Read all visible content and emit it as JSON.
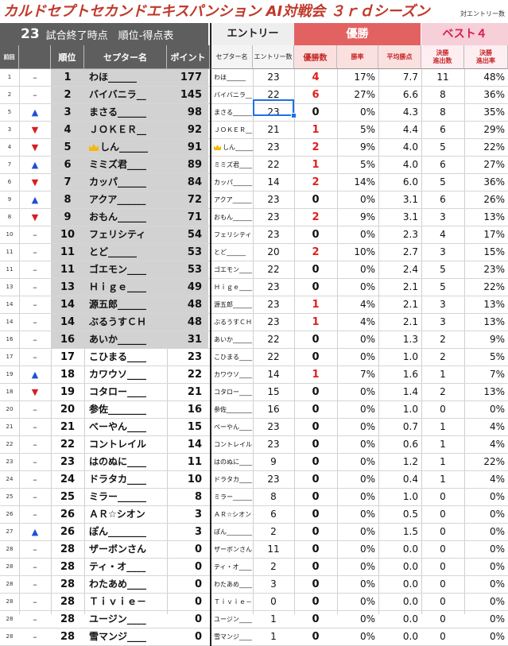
{
  "title": "カルドセプトセカンドエキスパンション AI対戦会 ３ｒｄシーズン",
  "subtitle": "対エントリー数",
  "header": {
    "match_count": "23",
    "count_label": "試合終了時点　順位-得点表",
    "entry_label": "エントリー",
    "win_label": "優勝",
    "best4_label": "ベスト４"
  },
  "columns": {
    "prev": "前回",
    "rank": "順位",
    "name": "セプター名",
    "points": "ポイント",
    "sname": "セプター名",
    "entries": "エントリー数",
    "wins": "優勝数",
    "win_rate": "勝率",
    "avg_points": "平均勝点",
    "finals": "決勝\n進出数",
    "finals_rate": "決勝\n進出率"
  },
  "colors": {
    "up_arrow": "#1f4fd6",
    "down_arrow": "#d61f1f",
    "win_header": "#e26262",
    "best4_header": "#f7cfd9",
    "header_dark": "#5e5e5e",
    "wins_red": "#e0201e",
    "selection": "#1a73e8"
  },
  "rows": [
    {
      "prev": "1",
      "change": "-",
      "rank": "1",
      "name": "わほ______",
      "points": "177",
      "sname": "わほ______",
      "entries": "23",
      "wins": "4",
      "win_rate": "17%",
      "avg": "7.7",
      "finals": "11",
      "finals_rate": "48%"
    },
    {
      "prev": "2",
      "change": "-",
      "rank": "2",
      "name": "バイバニラ__",
      "points": "145",
      "sname": "バイバニラ__",
      "entries": "22",
      "wins": "6",
      "win_rate": "27%",
      "avg": "6.6",
      "finals": "8",
      "finals_rate": "36%"
    },
    {
      "prev": "5",
      "change": "up",
      "rank": "3",
      "name": "まさる______",
      "points": "98",
      "sname": "まさる______",
      "entries": "23",
      "wins": "0",
      "win_rate": "0%",
      "avg": "4.3",
      "finals": "8",
      "finals_rate": "35%"
    },
    {
      "prev": "3",
      "change": "down",
      "rank": "4",
      "name": "ＪＯＫＥＲ__",
      "points": "92",
      "sname": "ＪＯＫＥＲ__",
      "entries": "21",
      "wins": "1",
      "win_rate": "5%",
      "avg": "4.4",
      "finals": "6",
      "finals_rate": "29%"
    },
    {
      "prev": "4",
      "change": "down",
      "rank": "5",
      "name": "しん______",
      "points": "91",
      "crown": true,
      "sname": "しん______",
      "entries": "23",
      "wins": "2",
      "win_rate": "9%",
      "avg": "4.0",
      "finals": "5",
      "finals_rate": "22%"
    },
    {
      "prev": "7",
      "change": "up",
      "rank": "6",
      "name": "ミミズ君____",
      "points": "89",
      "sname": "ミミズ君____",
      "entries": "22",
      "wins": "1",
      "win_rate": "5%",
      "avg": "4.0",
      "finals": "6",
      "finals_rate": "27%"
    },
    {
      "prev": "6",
      "change": "down",
      "rank": "7",
      "name": "カッパ______",
      "points": "84",
      "sname": "カッパ______",
      "entries": "14",
      "wins": "2",
      "win_rate": "14%",
      "avg": "6.0",
      "finals": "5",
      "finals_rate": "36%"
    },
    {
      "prev": "9",
      "change": "up",
      "rank": "8",
      "name": "アクア______",
      "points": "72",
      "sname": "アクア______",
      "entries": "23",
      "wins": "0",
      "win_rate": "0%",
      "avg": "3.1",
      "finals": "6",
      "finals_rate": "26%"
    },
    {
      "prev": "8",
      "change": "down",
      "rank": "9",
      "name": "おもん______",
      "points": "71",
      "sname": "おもん______",
      "entries": "23",
      "wins": "2",
      "win_rate": "9%",
      "avg": "3.1",
      "finals": "3",
      "finals_rate": "13%"
    },
    {
      "prev": "10",
      "change": "-",
      "rank": "10",
      "name": "フェリシティ",
      "points": "54",
      "sname": "フェリシティ",
      "entries": "23",
      "wins": "0",
      "win_rate": "0%",
      "avg": "2.3",
      "finals": "4",
      "finals_rate": "17%"
    },
    {
      "prev": "11",
      "change": "-",
      "rank": "11",
      "name": "とど______",
      "points": "53",
      "sname": "とど______",
      "entries": "20",
      "wins": "2",
      "win_rate": "10%",
      "avg": "2.7",
      "finals": "3",
      "finals_rate": "15%"
    },
    {
      "prev": "11",
      "change": "-",
      "rank": "11",
      "name": "ゴエモン____",
      "points": "53",
      "sname": "ゴエモン____",
      "entries": "22",
      "wins": "0",
      "win_rate": "0%",
      "avg": "2.4",
      "finals": "5",
      "finals_rate": "23%"
    },
    {
      "prev": "13",
      "change": "-",
      "rank": "13",
      "name": "Ｈｉｇｅ____",
      "points": "49",
      "sname": "Ｈｉｇｅ____",
      "entries": "23",
      "wins": "0",
      "win_rate": "0%",
      "avg": "2.1",
      "finals": "5",
      "finals_rate": "22%"
    },
    {
      "prev": "14",
      "change": "-",
      "rank": "14",
      "name": "源五郎______",
      "points": "48",
      "sname": "源五郎______",
      "entries": "23",
      "wins": "1",
      "win_rate": "4%",
      "avg": "2.1",
      "finals": "3",
      "finals_rate": "13%"
    },
    {
      "prev": "14",
      "change": "-",
      "rank": "14",
      "name": "ぶるうすＣＨ",
      "points": "48",
      "sname": "ぶるうすＣＨ",
      "entries": "23",
      "wins": "1",
      "win_rate": "4%",
      "avg": "2.1",
      "finals": "3",
      "finals_rate": "13%"
    },
    {
      "prev": "16",
      "change": "-",
      "rank": "16",
      "name": "あいか______",
      "points": "31",
      "sname": "あいか______",
      "entries": "22",
      "wins": "0",
      "win_rate": "0%",
      "avg": "1.3",
      "finals": "2",
      "finals_rate": "9%"
    },
    {
      "prev": "17",
      "change": "-",
      "rank": "17",
      "name": "こひまる____",
      "points": "23",
      "sname": "こひまる____",
      "entries": "22",
      "wins": "0",
      "win_rate": "0%",
      "avg": "1.0",
      "finals": "2",
      "finals_rate": "5%"
    },
    {
      "prev": "19",
      "change": "up",
      "rank": "18",
      "name": "カワウソ____",
      "points": "22",
      "sname": "カワウソ____",
      "entries": "14",
      "wins": "1",
      "win_rate": "7%",
      "avg": "1.6",
      "finals": "1",
      "finals_rate": "7%"
    },
    {
      "prev": "18",
      "change": "down",
      "rank": "19",
      "name": "コタロー____",
      "points": "21",
      "sname": "コタロー____",
      "entries": "15",
      "wins": "0",
      "win_rate": "0%",
      "avg": "1.4",
      "finals": "2",
      "finals_rate": "13%"
    },
    {
      "prev": "20",
      "change": "-",
      "rank": "20",
      "name": "参佐________",
      "points": "16",
      "sname": "参佐________",
      "entries": "16",
      "wins": "0",
      "win_rate": "0%",
      "avg": "1.0",
      "finals": "0",
      "finals_rate": "0%"
    },
    {
      "prev": "21",
      "change": "-",
      "rank": "21",
      "name": "べーやん____",
      "points": "15",
      "sname": "べーやん____",
      "entries": "23",
      "wins": "0",
      "win_rate": "0%",
      "avg": "0.7",
      "finals": "1",
      "finals_rate": "4%"
    },
    {
      "prev": "22",
      "change": "-",
      "rank": "22",
      "name": "コントレイル",
      "points": "14",
      "sname": "コントレイル",
      "entries": "23",
      "wins": "0",
      "win_rate": "0%",
      "avg": "0.6",
      "finals": "1",
      "finals_rate": "4%"
    },
    {
      "prev": "23",
      "change": "-",
      "rank": "23",
      "name": "はのぬに____",
      "points": "11",
      "sname": "はのぬに____",
      "entries": "9",
      "wins": "0",
      "win_rate": "0%",
      "avg": "1.2",
      "finals": "1",
      "finals_rate": "22%"
    },
    {
      "prev": "24",
      "change": "-",
      "rank": "24",
      "name": "ドラタカ____",
      "points": "10",
      "sname": "ドラタカ____",
      "entries": "23",
      "wins": "0",
      "win_rate": "0%",
      "avg": "0.4",
      "finals": "1",
      "finals_rate": "4%"
    },
    {
      "prev": "25",
      "change": "-",
      "rank": "25",
      "name": "ミラー______",
      "points": "8",
      "sname": "ミラー______",
      "entries": "8",
      "wins": "0",
      "win_rate": "0%",
      "avg": "1.0",
      "finals": "0",
      "finals_rate": "0%"
    },
    {
      "prev": "26",
      "change": "-",
      "rank": "26",
      "name": "ＡＲ☆シオン",
      "points": "3",
      "sname": "ＡＲ☆シオン",
      "entries": "6",
      "wins": "0",
      "win_rate": "0%",
      "avg": "0.5",
      "finals": "0",
      "finals_rate": "0%"
    },
    {
      "prev": "27",
      "change": "up",
      "rank": "26",
      "name": "ぽん________",
      "points": "3",
      "sname": "ぽん________",
      "entries": "2",
      "wins": "0",
      "win_rate": "0%",
      "avg": "1.5",
      "finals": "0",
      "finals_rate": "0%"
    },
    {
      "prev": "28",
      "change": "-",
      "rank": "28",
      "name": "ザーボンさん",
      "points": "0",
      "sname": "ザーボンさん",
      "entries": "11",
      "wins": "0",
      "win_rate": "0%",
      "avg": "0.0",
      "finals": "0",
      "finals_rate": "0%"
    },
    {
      "prev": "28",
      "change": "-",
      "rank": "28",
      "name": "ティ・オ____",
      "points": "0",
      "sname": "ティ・オ____",
      "entries": "2",
      "wins": "0",
      "win_rate": "0%",
      "avg": "0.0",
      "finals": "0",
      "finals_rate": "0%"
    },
    {
      "prev": "28",
      "change": "-",
      "rank": "28",
      "name": "わたあめ____",
      "points": "0",
      "sname": "わたあめ____",
      "entries": "3",
      "wins": "0",
      "win_rate": "0%",
      "avg": "0.0",
      "finals": "0",
      "finals_rate": "0%"
    },
    {
      "prev": "28",
      "change": "-",
      "rank": "28",
      "name": "Ｔｉｖｉｅ－",
      "points": "0",
      "sname": "Ｔｉｖｉｅ－",
      "entries": "0",
      "wins": "0",
      "win_rate": "0%",
      "avg": "0.0",
      "finals": "0",
      "finals_rate": "0%"
    },
    {
      "prev": "28",
      "change": "-",
      "rank": "28",
      "name": "ユージン____",
      "points": "0",
      "sname": "ユージン____",
      "entries": "1",
      "wins": "0",
      "win_rate": "0%",
      "avg": "0.0",
      "finals": "0",
      "finals_rate": "0%"
    },
    {
      "prev": "28",
      "change": "-",
      "rank": "28",
      "name": "雪マンジ____",
      "points": "0",
      "sname": "雪マンジ____",
      "entries": "1",
      "wins": "0",
      "win_rate": "0%",
      "avg": "0.0",
      "finals": "0",
      "finals_rate": "0%"
    }
  ]
}
